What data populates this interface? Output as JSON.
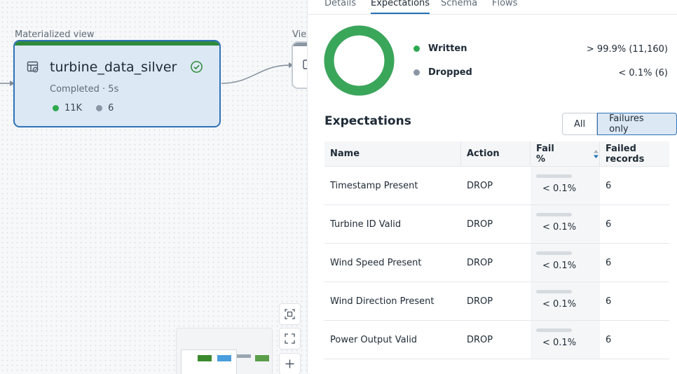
{
  "canvas": {
    "node_caption": "Materialized view",
    "next_node_caption": "Vie",
    "node": {
      "title": "turbine_data_silver",
      "status": "Completed · 5s",
      "written_count": "11K",
      "dropped_count": "6"
    }
  },
  "panel": {
    "tabs": [
      {
        "label": "Details"
      },
      {
        "label": "Expectations",
        "active": true
      },
      {
        "label": "Schema"
      },
      {
        "label": "Flows"
      }
    ],
    "summary": {
      "written_fraction": 0.999,
      "written_label": "Written",
      "written_value": "> 99.9% (11,160)",
      "dropped_label": "Dropped",
      "dropped_value": "< 0.1% (6)"
    },
    "expectations_title": "Expectations",
    "filter": {
      "all_label": "All",
      "failures_label": "Failures only",
      "selected": "Failures only"
    },
    "table": {
      "headers": [
        "Name",
        "Action",
        "Fail %",
        "Failed records"
      ],
      "rows": [
        {
          "name": "Timestamp Present",
          "action": "DROP",
          "fail": "< 0.1%",
          "failed": "6"
        },
        {
          "name": "Turbine ID Valid",
          "action": "DROP",
          "fail": "< 0.1%",
          "failed": "6"
        },
        {
          "name": "Wind Speed Present",
          "action": "DROP",
          "fail": "< 0.1%",
          "failed": "6"
        },
        {
          "name": "Wind Direction Present",
          "action": "DROP",
          "fail": "< 0.1%",
          "failed": "6"
        },
        {
          "name": "Power Output Valid",
          "action": "DROP",
          "fail": "< 0.1%",
          "failed": "6"
        }
      ]
    }
  },
  "colors": {
    "written": "#2fa84f",
    "dropped": "#8a96a3",
    "accent": "#2272b4",
    "node_bar": "#2e8a3a"
  }
}
